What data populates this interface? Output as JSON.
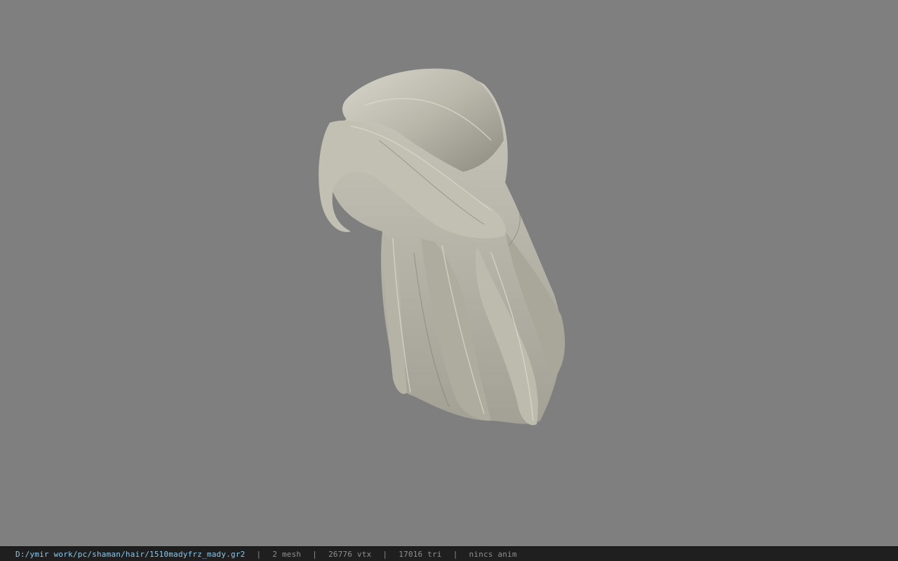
{
  "viewer": {
    "background_color": "#7f7f7f",
    "model_color": "#c8c6b8",
    "model_subject": "hair-mesh"
  },
  "status_bar": {
    "file_path": "D:/ymir work/pc/shaman/hair/1510madyfrz_mady.gr2",
    "separator": "|",
    "mesh_count": "2 mesh",
    "vertex_count": "26776 vtx",
    "triangle_count": "17016 tri",
    "anim_status": "nincs anim",
    "path_color": "#8fc7e8",
    "text_color": "#8f8f8f",
    "background_color": "#1f1f1f"
  }
}
